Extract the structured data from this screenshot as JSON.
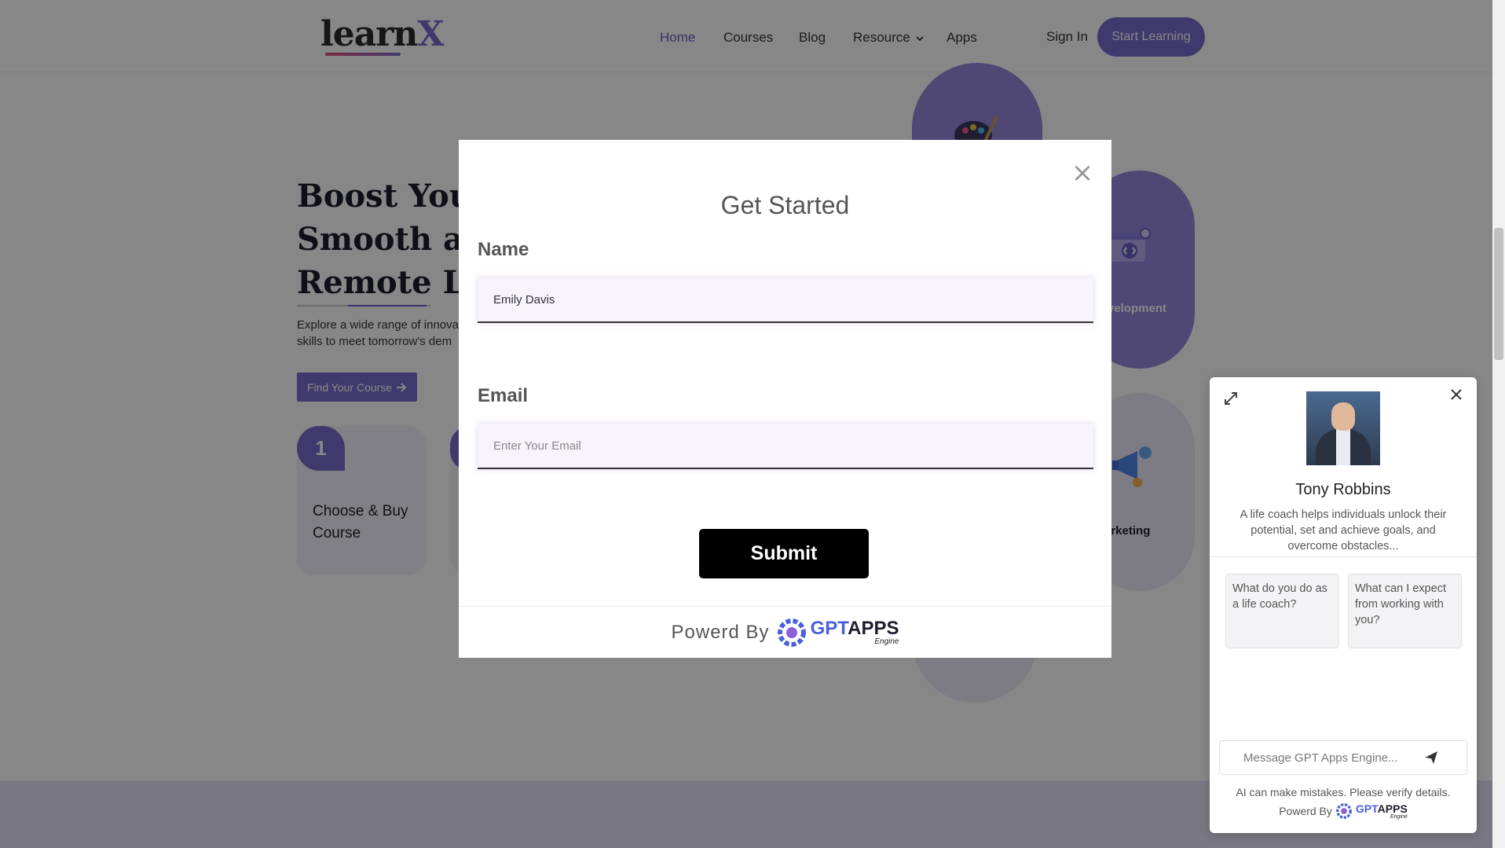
{
  "header": {
    "logo": {
      "main": "learn",
      "accent": "X"
    },
    "nav": [
      {
        "label": "Home",
        "active": true
      },
      {
        "label": "Courses"
      },
      {
        "label": "Blog"
      },
      {
        "label": "Resource",
        "has_dropdown": true
      },
      {
        "label": "Apps"
      }
    ],
    "signin_label": "Sign In",
    "cta_label": "Start Learning"
  },
  "hero": {
    "title_line1": "Boost Your S",
    "title_line2": "Smooth and",
    "title_line3": "Remote Lear",
    "desc_line1": "Explore a wide range of innova",
    "desc_line2": "skills to meet tomorrow's dem",
    "button_label": "Find Your Course",
    "steps": [
      {
        "number": "1",
        "label": "Choose & Buy Course"
      }
    ]
  },
  "categories": [
    {
      "label": "velopment"
    },
    {
      "label": "arketing"
    }
  ],
  "modal": {
    "title": "Get Started",
    "name_label": "Name",
    "name_value": "Emily Davis",
    "email_label": "Email",
    "email_placeholder": "Enter Your Email",
    "submit_label": "Submit",
    "footer_text": "Powerd By",
    "brand_gpt": "GPT",
    "brand_apps": "APPS",
    "brand_sub": "Engine"
  },
  "chat": {
    "name": "Tony Robbins",
    "description": "A life coach helps individuals unlock their potential, set and achieve goals, and overcome obstacles...",
    "suggestions": [
      "What do you do as a life coach?",
      "What can I expect from working with you?"
    ],
    "input_placeholder": "Message GPT Apps Engine...",
    "disclaimer": "AI can make mistakes. Please verify details.",
    "powered_text": "Powerd By",
    "brand_gpt": "GPT",
    "brand_apps": "APPS",
    "brand_sub": "Engine"
  },
  "colors": {
    "accent": "#7a6dcf",
    "overlay": "rgba(0,0,0,0.47)",
    "submit": "#000000"
  },
  "icons": [
    "chevron-down-icon",
    "arrow-right-icon",
    "close-icon",
    "expand-icon",
    "send-icon",
    "gptapps-gear-icon"
  ]
}
